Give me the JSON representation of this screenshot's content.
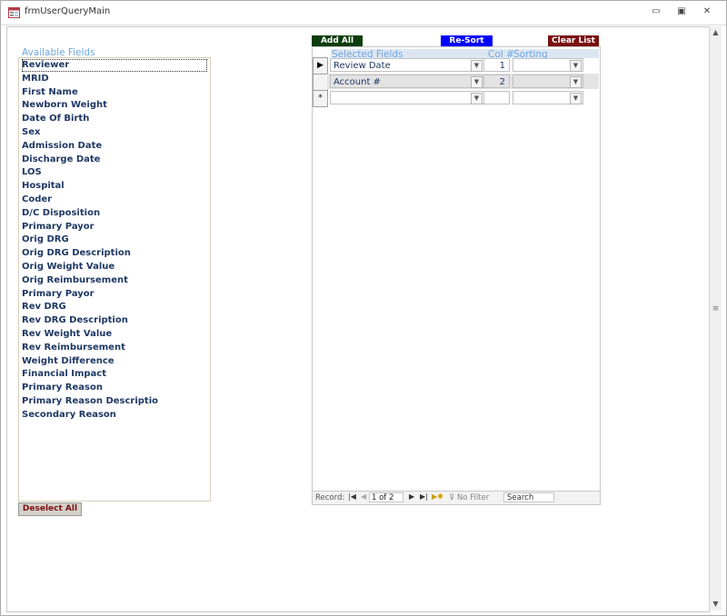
{
  "window": {
    "title": "frmUserQueryMain",
    "icons": [
      "form-icon",
      "minimize-icon",
      "restore-icon",
      "close-icon"
    ],
    "controls": {
      "minimize": "▭",
      "restore": "▣",
      "close": "✕"
    }
  },
  "available": {
    "label": "Available Fields",
    "items": [
      "Reviewer",
      "MRID",
      "First Name",
      "Newborn Weight",
      "Date Of Birth",
      "Sex",
      "Admission Date",
      "Discharge Date",
      "LOS",
      "Hospital",
      "Coder",
      "D/C Disposition",
      "Primary Payor",
      "Orig DRG",
      "Orig DRG Description",
      "Orig Weight Value",
      "Orig Reimbursement",
      "Primary Payor",
      "Rev DRG",
      "Rev DRG Description",
      "Rev Weight Value",
      "Rev Reimbursement",
      "Weight Difference",
      "Financial Impact",
      "Primary Reason",
      "Primary Reason Descriptio",
      "Secondary Reason"
    ],
    "selected_index": 0
  },
  "buttons": {
    "deselect_all": "Deselect All",
    "add_all": "Add All",
    "re_sort": "Re-Sort",
    "clear_list": "Clear List"
  },
  "subform": {
    "headers": {
      "selected_fields": "Selected Fields",
      "col_no": "Col #",
      "sorting": "Sorting"
    },
    "rows": [
      {
        "field": "Review Date",
        "col": "1",
        "sorting": ""
      },
      {
        "field": "Account #",
        "col": "2",
        "sorting": ""
      }
    ],
    "new_row_marker": "*",
    "current_row_marker": "▶"
  },
  "navigation": {
    "record_label": "Record:",
    "position": "1 of 2",
    "no_filter": "No Filter",
    "search_placeholder": "Search",
    "glyphs": {
      "first": "|◀",
      "prev": "◀",
      "next": "▶",
      "last": "▶|",
      "new": "▶✱"
    }
  },
  "colors": {
    "add_all": "#0b3d0b",
    "re_sort": "#0000ff",
    "clear_list": "#7a0f0f",
    "label_blue": "#6fa6e2",
    "text_navy": "#1f3864",
    "deselect_text": "#7b1113"
  }
}
